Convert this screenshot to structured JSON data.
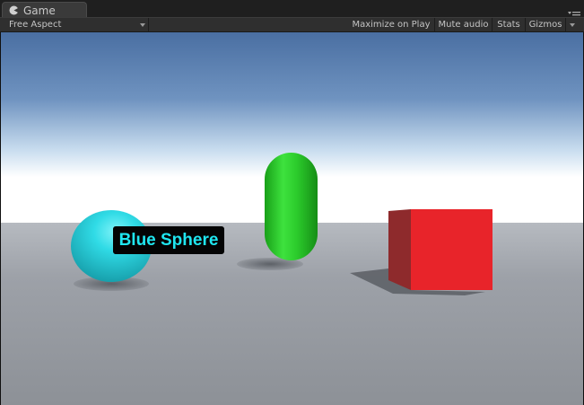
{
  "tab": {
    "title": "Game",
    "icon": "pacman-game-icon"
  },
  "toolbar": {
    "aspect": "Free Aspect",
    "maximize": "Maximize on Play",
    "mute": "Mute audio",
    "stats": "Stats",
    "gizmos": "Gizmos"
  },
  "scene": {
    "label": "Blue Sphere",
    "label_color": "#1fe6f0",
    "objects": [
      {
        "name": "sphere",
        "color": "#2ad8e4"
      },
      {
        "name": "capsule",
        "color": "#22d322"
      },
      {
        "name": "cube",
        "color": "#e8242a"
      }
    ]
  }
}
